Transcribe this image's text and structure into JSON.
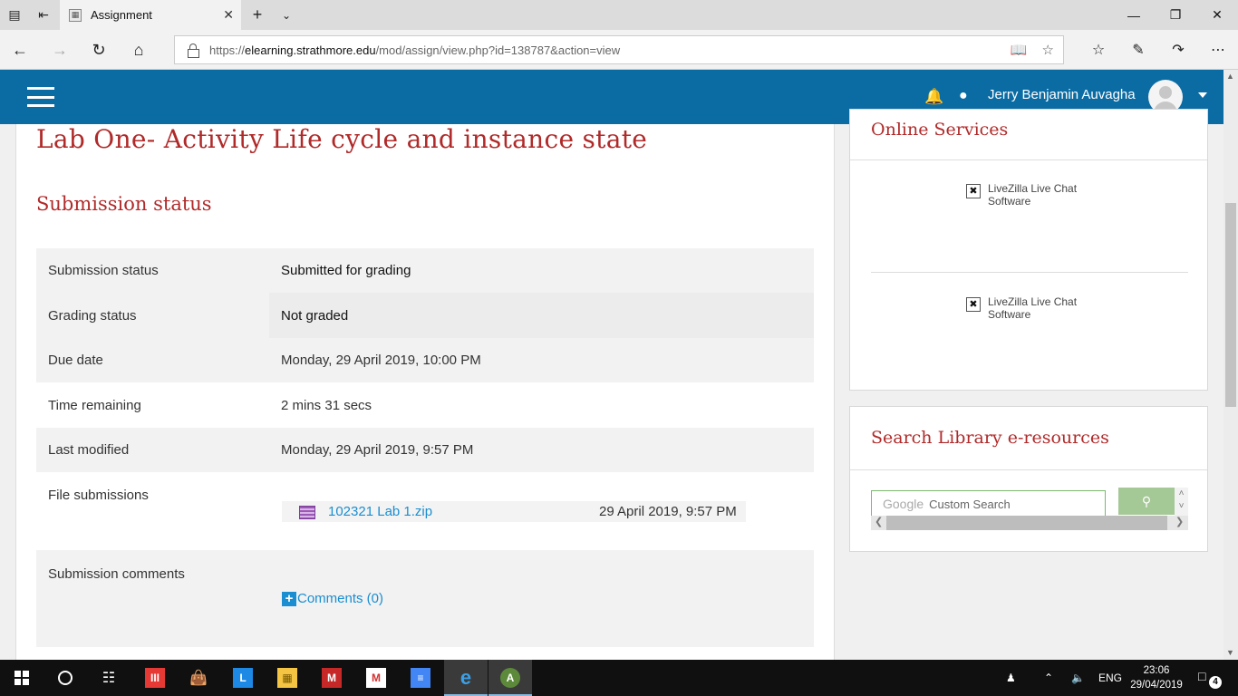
{
  "browser": {
    "tab_title": "Assignment",
    "url_domain": "elearning.strathmore.edu",
    "url_prefix": "https://",
    "url_path": "/mod/assign/view.php?id=138787&action=view"
  },
  "header": {
    "user_name": "Jerry Benjamin Auvagha",
    "brand_color": "#0b6ca4"
  },
  "main": {
    "title": "Lab One- Activity Life cycle and instance state",
    "section_title": "Submission status",
    "rows": [
      {
        "label": "Submission status",
        "value": "Submitted for grading"
      },
      {
        "label": "Grading status",
        "value": "Not graded"
      },
      {
        "label": "Due date",
        "value": "Monday, 29 April 2019, 10:00 PM"
      },
      {
        "label": "Time remaining",
        "value": "2 mins 31 secs"
      },
      {
        "label": "Last modified",
        "value": "Monday, 29 April 2019, 9:57 PM"
      }
    ],
    "file_submissions": {
      "label": "File submissions",
      "file_name": "102321 Lab 1.zip",
      "file_date": "29 April 2019, 9:57 PM"
    },
    "submission_comments": {
      "label": "Submission comments",
      "link": "Comments (0)"
    }
  },
  "sidebar": {
    "online_services": {
      "title": "Online Services",
      "items": [
        {
          "line1": "LiveZilla Live Chat",
          "line2": "Software"
        },
        {
          "line1": "LiveZilla Live Chat",
          "line2": "Software"
        }
      ]
    },
    "library": {
      "title": "Search Library e-resources",
      "google_logo": "Google",
      "placeholder": "Custom Search"
    }
  },
  "taskbar": {
    "language": "ENG",
    "time": "23:06",
    "date": "29/04/2019",
    "notification_count": "4"
  },
  "colors": {
    "title_red": "#b02a2a",
    "link_blue": "#1a8ed1"
  }
}
